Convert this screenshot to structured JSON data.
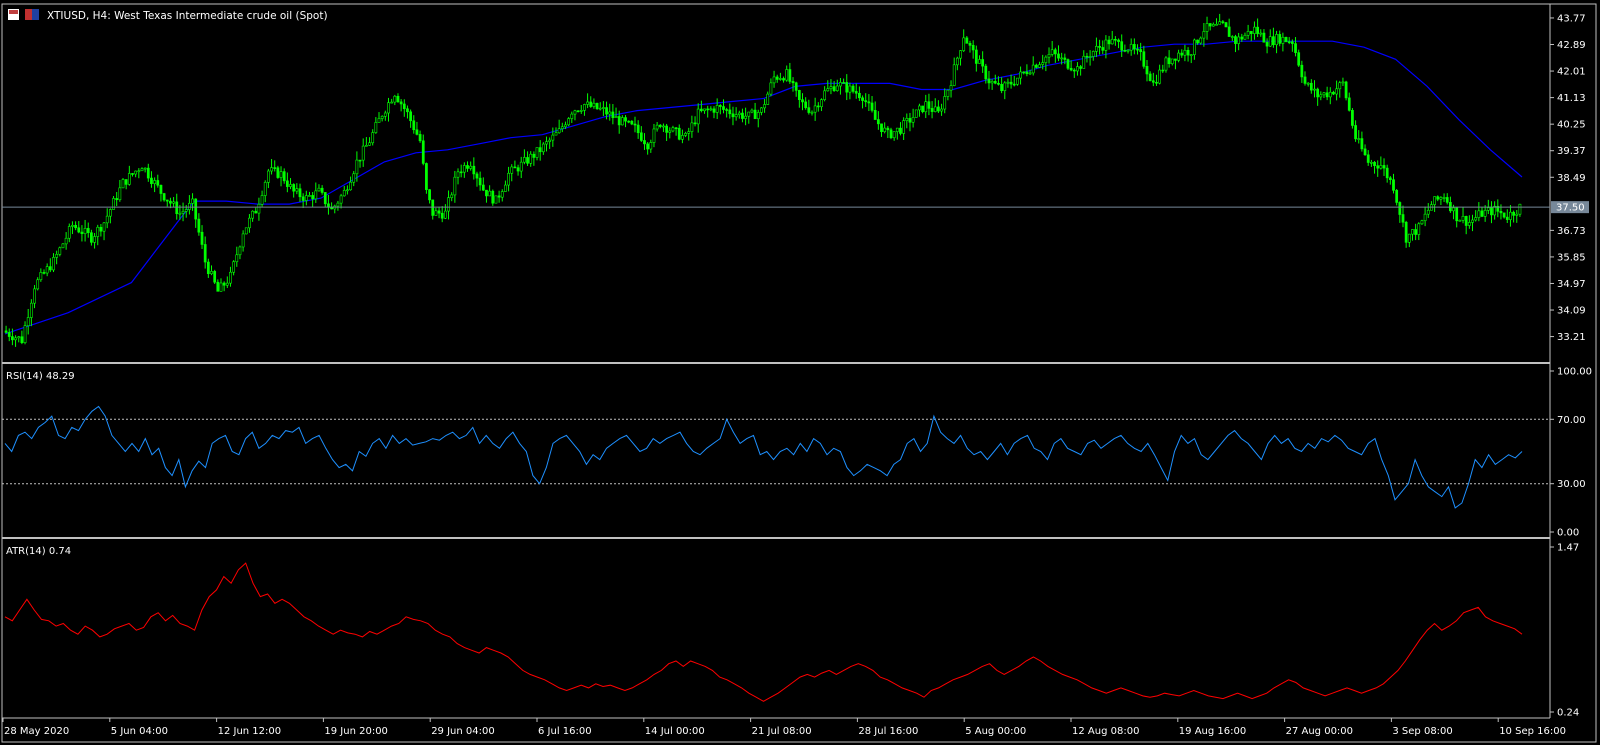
{
  "header": {
    "symbol": "XTIUSD",
    "timeframe": "H4",
    "description": "West Texas Intermediate crude oil (Spot)",
    "title_text": "XTIUSD, H4:  West Texas Intermediate crude oil (Spot)"
  },
  "colors": {
    "background": "#000000",
    "border": "#c0c0c0",
    "candle_bull_body": "#000000",
    "candle_outline": "#00ff00",
    "moving_average": "#0000ff",
    "rsi_line": "#1e90ff",
    "atr_line": "#ff0000",
    "price_line": "#778899",
    "current_price_badge": "#778899"
  },
  "chart_data": [
    {
      "type": "candlestick",
      "name": "price",
      "title": "XTIUSD, H4:  West Texas Intermediate crude oil (Spot)",
      "y_ticks": [
        "43.77",
        "42.89",
        "42.01",
        "41.13",
        "40.25",
        "39.37",
        "38.49",
        "37.50",
        "36.73",
        "35.85",
        "34.97",
        "34.09",
        "33.21"
      ],
      "ylim": [
        32.5,
        44.1
      ],
      "current_price": "37.50",
      "x_ticks": [
        "28 May 2020",
        "5 Jun 04:00",
        "12 Jun 12:00",
        "19 Jun 20:00",
        "29 Jun 04:00",
        "6 Jul 16:00",
        "14 Jul 00:00",
        "21 Jul 08:00",
        "28 Jul 16:00",
        "5 Aug 00:00",
        "12 Aug 08:00",
        "19 Aug 16:00",
        "27 Aug 00:00",
        "3 Sep 08:00",
        "10 Sep 16:00"
      ],
      "close_path": [
        [
          0,
          33.4
        ],
        [
          6,
          33.1
        ],
        [
          10,
          34.9
        ],
        [
          16,
          35.7
        ],
        [
          22,
          36.9
        ],
        [
          28,
          36.5
        ],
        [
          32,
          37.0
        ],
        [
          38,
          38.3
        ],
        [
          44,
          38.9
        ],
        [
          50,
          38.0
        ],
        [
          56,
          37.3
        ],
        [
          60,
          37.6
        ],
        [
          64,
          35.7
        ],
        [
          68,
          34.7
        ],
        [
          72,
          35.2
        ],
        [
          76,
          36.7
        ],
        [
          80,
          37.4
        ],
        [
          84,
          38.7
        ],
        [
          88,
          38.6
        ],
        [
          92,
          38.0
        ],
        [
          96,
          37.8
        ],
        [
          100,
          38.0
        ],
        [
          104,
          37.4
        ],
        [
          108,
          38.0
        ],
        [
          112,
          39.0
        ],
        [
          116,
          39.7
        ],
        [
          120,
          40.6
        ],
        [
          124,
          41.3
        ],
        [
          128,
          40.6
        ],
        [
          132,
          39.7
        ],
        [
          134,
          38.0
        ],
        [
          136,
          37.3
        ],
        [
          140,
          37.3
        ],
        [
          144,
          38.7
        ],
        [
          148,
          39.0
        ],
        [
          152,
          38.1
        ],
        [
          156,
          37.7
        ],
        [
          160,
          38.6
        ],
        [
          164,
          38.9
        ],
        [
          170,
          39.4
        ],
        [
          176,
          40.0
        ],
        [
          180,
          40.7
        ],
        [
          184,
          40.9
        ],
        [
          190,
          40.7
        ],
        [
          196,
          40.3
        ],
        [
          200,
          40.1
        ],
        [
          204,
          39.6
        ],
        [
          208,
          40.3
        ],
        [
          212,
          40.0
        ],
        [
          216,
          39.8
        ],
        [
          220,
          40.6
        ],
        [
          226,
          40.8
        ],
        [
          232,
          40.6
        ],
        [
          236,
          40.5
        ],
        [
          240,
          40.7
        ],
        [
          244,
          41.8
        ],
        [
          248,
          41.9
        ],
        [
          252,
          41.0
        ],
        [
          256,
          40.7
        ],
        [
          260,
          41.3
        ],
        [
          264,
          41.6
        ],
        [
          268,
          41.4
        ],
        [
          272,
          41.2
        ],
        [
          276,
          40.4
        ],
        [
          280,
          39.9
        ],
        [
          284,
          40.1
        ],
        [
          288,
          40.5
        ],
        [
          292,
          40.9
        ],
        [
          296,
          40.6
        ],
        [
          300,
          41.7
        ],
        [
          304,
          43.2
        ],
        [
          308,
          42.4
        ],
        [
          312,
          41.7
        ],
        [
          316,
          41.4
        ],
        [
          320,
          41.7
        ],
        [
          326,
          42.2
        ],
        [
          332,
          42.6
        ],
        [
          336,
          42.3
        ],
        [
          340,
          42.1
        ],
        [
          344,
          42.6
        ],
        [
          350,
          43.0
        ],
        [
          356,
          42.8
        ],
        [
          360,
          42.5
        ],
        [
          364,
          41.6
        ],
        [
          368,
          42.3
        ],
        [
          372,
          42.6
        ],
        [
          376,
          42.7
        ],
        [
          380,
          43.4
        ],
        [
          386,
          43.5
        ],
        [
          390,
          43.0
        ],
        [
          396,
          43.4
        ],
        [
          400,
          43.0
        ],
        [
          404,
          43.1
        ],
        [
          408,
          43.0
        ],
        [
          412,
          41.6
        ],
        [
          416,
          41.2
        ],
        [
          420,
          41.3
        ],
        [
          424,
          41.6
        ],
        [
          428,
          39.8
        ],
        [
          432,
          39.0
        ],
        [
          436,
          38.9
        ],
        [
          440,
          38.2
        ],
        [
          444,
          36.5
        ],
        [
          448,
          36.8
        ],
        [
          452,
          37.6
        ],
        [
          456,
          37.9
        ],
        [
          460,
          37.2
        ],
        [
          464,
          37.0
        ],
        [
          468,
          37.3
        ],
        [
          472,
          37.4
        ],
        [
          476,
          37.2
        ],
        [
          480,
          37.5
        ]
      ],
      "ma_path": [
        [
          0,
          33.3
        ],
        [
          20,
          34.0
        ],
        [
          40,
          35.0
        ],
        [
          56,
          37.2
        ],
        [
          60,
          37.7
        ],
        [
          70,
          37.7
        ],
        [
          80,
          37.6
        ],
        [
          90,
          37.6
        ],
        [
          100,
          37.8
        ],
        [
          110,
          38.4
        ],
        [
          120,
          39.0
        ],
        [
          130,
          39.3
        ],
        [
          140,
          39.4
        ],
        [
          150,
          39.6
        ],
        [
          160,
          39.8
        ],
        [
          170,
          39.9
        ],
        [
          180,
          40.2
        ],
        [
          190,
          40.5
        ],
        [
          200,
          40.7
        ],
        [
          210,
          40.8
        ],
        [
          220,
          40.9
        ],
        [
          230,
          41.0
        ],
        [
          240,
          41.1
        ],
        [
          250,
          41.5
        ],
        [
          260,
          41.6
        ],
        [
          270,
          41.6
        ],
        [
          280,
          41.6
        ],
        [
          290,
          41.4
        ],
        [
          300,
          41.4
        ],
        [
          310,
          41.7
        ],
        [
          320,
          41.9
        ],
        [
          330,
          42.2
        ],
        [
          340,
          42.4
        ],
        [
          350,
          42.6
        ],
        [
          360,
          42.8
        ],
        [
          370,
          42.9
        ],
        [
          380,
          42.9
        ],
        [
          390,
          43.0
        ],
        [
          400,
          43.0
        ],
        [
          410,
          43.0
        ],
        [
          420,
          43.0
        ],
        [
          430,
          42.8
        ],
        [
          440,
          42.4
        ],
        [
          450,
          41.5
        ],
        [
          460,
          40.4
        ],
        [
          470,
          39.4
        ],
        [
          480,
          38.5
        ]
      ],
      "n_bars": 480
    },
    {
      "type": "line",
      "name": "rsi",
      "title": "RSI(14) 48.29",
      "y_ticks": [
        "100.00",
        "70.00",
        "30.00",
        "0.00"
      ],
      "ylim": [
        0,
        100
      ],
      "levels": [
        70,
        30
      ],
      "series": [
        {
          "name": "RSI(14)",
          "values": [
            55,
            50,
            60,
            62,
            58,
            65,
            68,
            72,
            60,
            58,
            65,
            63,
            70,
            75,
            78,
            72,
            60,
            55,
            50,
            55,
            50,
            58,
            48,
            52,
            40,
            35,
            45,
            28,
            38,
            44,
            40,
            55,
            58,
            60,
            50,
            48,
            58,
            62,
            52,
            55,
            60,
            58,
            63,
            62,
            65,
            55,
            58,
            60,
            52,
            45,
            40,
            42,
            38,
            50,
            47,
            55,
            58,
            52,
            60,
            55,
            58,
            54,
            55,
            56,
            58,
            57,
            60,
            62,
            58,
            60,
            65,
            55,
            60,
            55,
            52,
            58,
            62,
            55,
            50,
            35,
            30,
            40,
            55,
            58,
            60,
            55,
            50,
            42,
            48,
            45,
            52,
            55,
            58,
            60,
            55,
            50,
            52,
            58,
            55,
            58,
            60,
            62,
            55,
            50,
            48,
            52,
            55,
            58,
            70,
            62,
            55,
            58,
            60,
            48,
            50,
            45,
            50,
            52,
            48,
            55,
            50,
            58,
            55,
            48,
            52,
            50,
            40,
            35,
            38,
            42,
            40,
            38,
            35,
            42,
            45,
            55,
            58,
            50,
            55,
            72,
            62,
            58,
            55,
            60,
            52,
            48,
            50,
            45,
            50,
            55,
            48,
            55,
            58,
            60,
            52,
            50,
            45,
            55,
            58,
            52,
            50,
            48,
            55,
            57,
            52,
            55,
            58,
            60,
            55,
            52,
            50,
            55,
            48,
            40,
            32,
            50,
            60,
            55,
            58,
            48,
            45,
            50,
            55,
            60,
            63,
            58,
            55,
            50,
            45,
            55,
            60,
            55,
            58,
            52,
            50,
            55,
            52,
            58,
            56,
            60,
            57,
            52,
            50,
            48,
            55,
            58,
            45,
            35,
            20,
            25,
            30,
            45,
            35,
            28,
            25,
            22,
            28,
            15,
            18,
            30,
            45,
            40,
            48,
            42,
            45,
            48,
            46,
            50
          ]
        }
      ]
    },
    {
      "type": "line",
      "name": "atr",
      "title": "ATR(14) 0.74",
      "y_ticks": [
        "1.47",
        "0.24"
      ],
      "ylim": [
        0.24,
        1.47
      ],
      "series": [
        {
          "name": "ATR(14)",
          "values": [
            0.95,
            0.92,
            1.0,
            1.08,
            1.0,
            0.93,
            0.92,
            0.88,
            0.9,
            0.85,
            0.82,
            0.88,
            0.85,
            0.8,
            0.82,
            0.86,
            0.88,
            0.9,
            0.85,
            0.87,
            0.95,
            0.98,
            0.92,
            0.96,
            0.9,
            0.88,
            0.85,
            1.0,
            1.1,
            1.15,
            1.25,
            1.2,
            1.3,
            1.35,
            1.2,
            1.1,
            1.12,
            1.05,
            1.08,
            1.05,
            1.0,
            0.95,
            0.92,
            0.88,
            0.85,
            0.82,
            0.85,
            0.83,
            0.82,
            0.8,
            0.84,
            0.82,
            0.85,
            0.88,
            0.9,
            0.95,
            0.93,
            0.92,
            0.9,
            0.85,
            0.82,
            0.8,
            0.75,
            0.72,
            0.7,
            0.68,
            0.72,
            0.7,
            0.68,
            0.65,
            0.6,
            0.55,
            0.52,
            0.5,
            0.48,
            0.45,
            0.42,
            0.4,
            0.42,
            0.44,
            0.42,
            0.45,
            0.43,
            0.44,
            0.42,
            0.4,
            0.42,
            0.45,
            0.48,
            0.52,
            0.55,
            0.6,
            0.62,
            0.58,
            0.62,
            0.6,
            0.58,
            0.55,
            0.5,
            0.48,
            0.45,
            0.42,
            0.38,
            0.35,
            0.32,
            0.35,
            0.38,
            0.42,
            0.46,
            0.5,
            0.52,
            0.5,
            0.53,
            0.55,
            0.52,
            0.55,
            0.58,
            0.6,
            0.58,
            0.55,
            0.5,
            0.48,
            0.45,
            0.42,
            0.4,
            0.38,
            0.35,
            0.4,
            0.42,
            0.45,
            0.48,
            0.5,
            0.52,
            0.55,
            0.58,
            0.6,
            0.55,
            0.52,
            0.55,
            0.58,
            0.62,
            0.65,
            0.62,
            0.58,
            0.55,
            0.52,
            0.5,
            0.48,
            0.45,
            0.42,
            0.4,
            0.38,
            0.4,
            0.42,
            0.4,
            0.38,
            0.36,
            0.35,
            0.36,
            0.38,
            0.37,
            0.36,
            0.38,
            0.4,
            0.38,
            0.36,
            0.35,
            0.34,
            0.36,
            0.38,
            0.36,
            0.34,
            0.36,
            0.38,
            0.42,
            0.45,
            0.48,
            0.46,
            0.42,
            0.4,
            0.38,
            0.36,
            0.38,
            0.4,
            0.42,
            0.4,
            0.38,
            0.4,
            0.42,
            0.45,
            0.5,
            0.55,
            0.62,
            0.7,
            0.78,
            0.85,
            0.9,
            0.85,
            0.88,
            0.92,
            0.98,
            1.0,
            1.02,
            0.95,
            0.92,
            0.9,
            0.88,
            0.86,
            0.82
          ]
        }
      ]
    }
  ]
}
